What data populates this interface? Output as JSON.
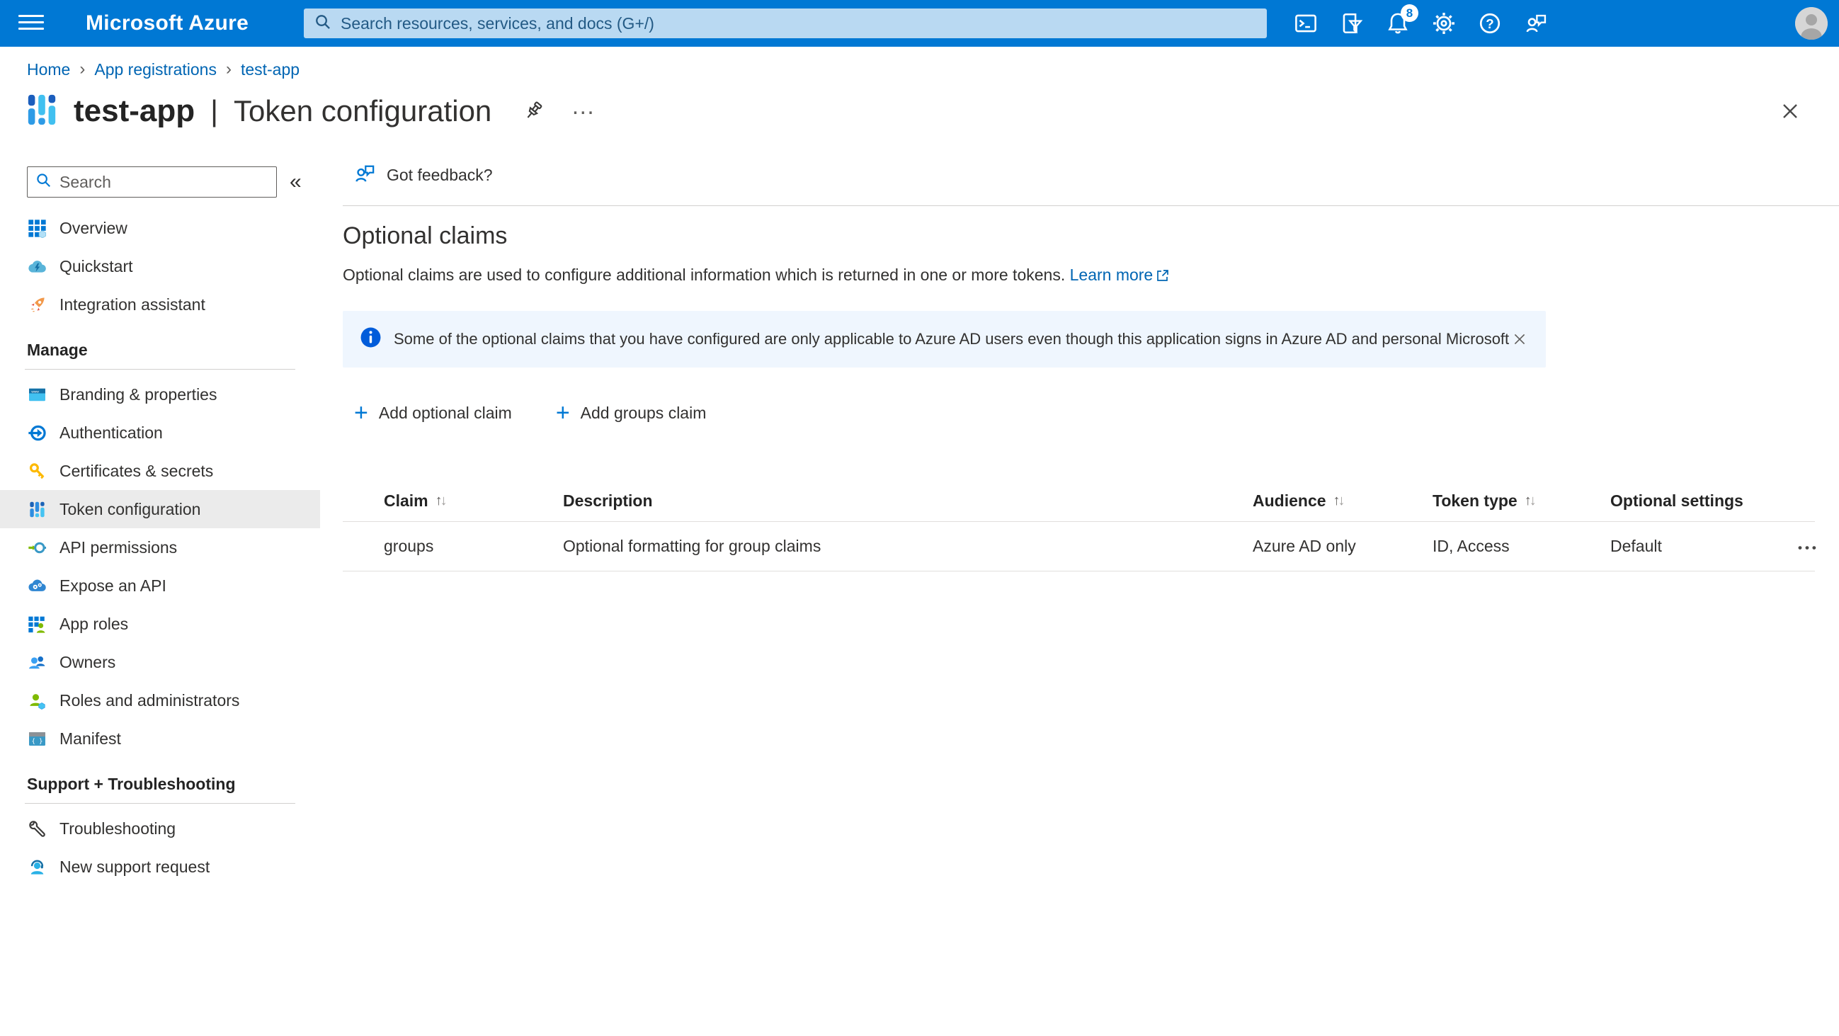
{
  "colors": {
    "topbar_blue": "#0078d4",
    "accent_blue": "#0078d4",
    "link_blue": "#0065b3",
    "selected_item_bg": "#ebebeb",
    "info_banner_bg": "#eff6fe",
    "info_icon_blue": "#015cda",
    "text_primary": "#323130"
  },
  "icons": {
    "chevron": "›",
    "collapse": "«",
    "plus": "+",
    "sort_up": "↑",
    "sort_down": "↓",
    "row_actions": "•••",
    "title_more": "…"
  },
  "topbar": {
    "brand": "Microsoft Azure",
    "search_placeholder": "Search resources, services, and docs (G+/)",
    "notification_count": "8"
  },
  "breadcrumb": {
    "home": "Home",
    "app_registrations": "App registrations",
    "app": "test-app"
  },
  "blade": {
    "app_name": "test-app",
    "separator": "|",
    "section": "Token configuration"
  },
  "sidebar": {
    "search_placeholder": "Search",
    "items": {
      "overview": "Overview",
      "quickstart": "Quickstart",
      "integration_assistant": "Integration assistant",
      "manage_header": "Manage",
      "branding": "Branding & properties",
      "authentication": "Authentication",
      "certificates": "Certificates & secrets",
      "token_configuration": "Token configuration",
      "api_permissions": "API permissions",
      "expose_api": "Expose an API",
      "app_roles": "App roles",
      "owners": "Owners",
      "roles_admins": "Roles and administrators",
      "manifest": "Manifest",
      "support_header": "Support + Troubleshooting",
      "troubleshooting": "Troubleshooting",
      "new_support_request": "New support request"
    }
  },
  "main": {
    "feedback_button": "Got feedback?",
    "section_title": "Optional claims",
    "description": "Optional claims are used to configure additional information which is returned in one or more tokens.",
    "learn_more": "Learn more",
    "banner_text": "Some of the optional claims that you have configured are only applicable to Azure AD users even though this application signs in Azure AD and personal Microsoft accounts.",
    "add_optional_claim": "Add optional claim",
    "add_groups_claim": "Add groups claim",
    "table": {
      "headers": {
        "claim": "Claim",
        "description": "Description",
        "audience": "Audience",
        "token_type": "Token type",
        "optional_settings": "Optional settings"
      },
      "row": {
        "claim": "groups",
        "description": "Optional formatting for group claims",
        "audience": "Azure AD only",
        "token_type": "ID, Access",
        "optional_settings": "Default"
      }
    }
  }
}
